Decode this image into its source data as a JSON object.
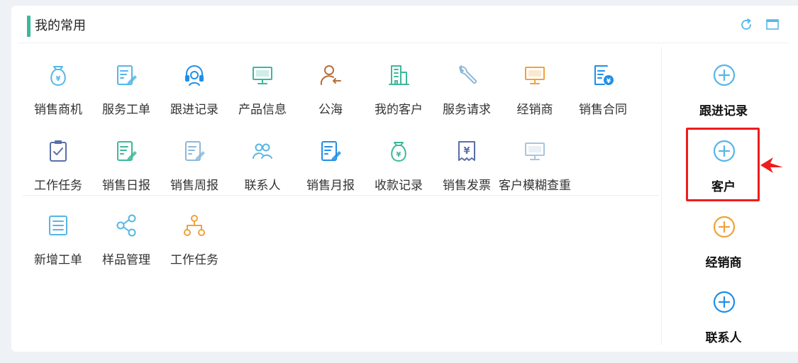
{
  "header": {
    "title": "我的常用",
    "refresh_icon": "refresh-icon",
    "maximize_icon": "maximize-icon",
    "accent_color": "#3db89a"
  },
  "favorites": [
    {
      "label": "销售商机",
      "icon": "money-bag-icon",
      "color": "#56b6e6"
    },
    {
      "label": "服务工单",
      "icon": "edit-document-icon",
      "color": "#56b6e6"
    },
    {
      "label": "跟进记录",
      "icon": "headset-icon",
      "color": "#1f8fe8"
    },
    {
      "label": "产品信息",
      "icon": "monitor-icon",
      "color": "#3db89a"
    },
    {
      "label": "公海",
      "icon": "user-return-icon",
      "color": "#b5703a"
    },
    {
      "label": "我的客户",
      "icon": "building-icon",
      "color": "#3db89a"
    },
    {
      "label": "服务请求",
      "icon": "wrench-icon",
      "color": "#8fb8d8"
    },
    {
      "label": "经销商",
      "icon": "monitor-icon",
      "color": "#f0a23b"
    },
    {
      "label": "销售合同",
      "icon": "contract-yen-icon",
      "color": "#1f8fe8"
    },
    {
      "label": "工作任务",
      "icon": "clipboard-check-icon",
      "color": "#5b6fa6"
    },
    {
      "label": "销售日报",
      "icon": "edit-document-icon",
      "color": "#3db89a"
    },
    {
      "label": "销售周报",
      "icon": "edit-document-icon",
      "color": "#8fb8d8"
    },
    {
      "label": "联系人",
      "icon": "contacts-icon",
      "color": "#56b6e6"
    },
    {
      "label": "销售月报",
      "icon": "edit-document-icon",
      "color": "#1f8fe8"
    },
    {
      "label": "收款记录",
      "icon": "money-bag-icon",
      "color": "#3db89a"
    },
    {
      "label": "销售发票",
      "icon": "invoice-yen-icon",
      "color": "#5b6fa6"
    },
    {
      "label": "客户模糊查重",
      "icon": "monitor-icon",
      "color": "#a8c6dc"
    },
    {
      "label": "新增工单",
      "icon": "form-icon",
      "color": "#56b6e6"
    },
    {
      "label": "样品管理",
      "icon": "share-icon",
      "color": "#56b6e6"
    },
    {
      "label": "工作任务",
      "icon": "org-chart-icon",
      "color": "#f0a23b"
    }
  ],
  "quick_add": [
    {
      "label": "跟进记录",
      "icon": "plus-circle-icon",
      "color": "#56b6e6"
    },
    {
      "label": "客户",
      "icon": "plus-circle-icon",
      "color": "#56b6e6"
    },
    {
      "label": "经销商",
      "icon": "plus-circle-icon",
      "color": "#f0a23b"
    },
    {
      "label": "联系人",
      "icon": "plus-circle-icon",
      "color": "#1f8fe8"
    }
  ],
  "annotation": {
    "highlight_color": "#ee1c1c",
    "arrow_icon": "pointer-arrow-icon"
  }
}
